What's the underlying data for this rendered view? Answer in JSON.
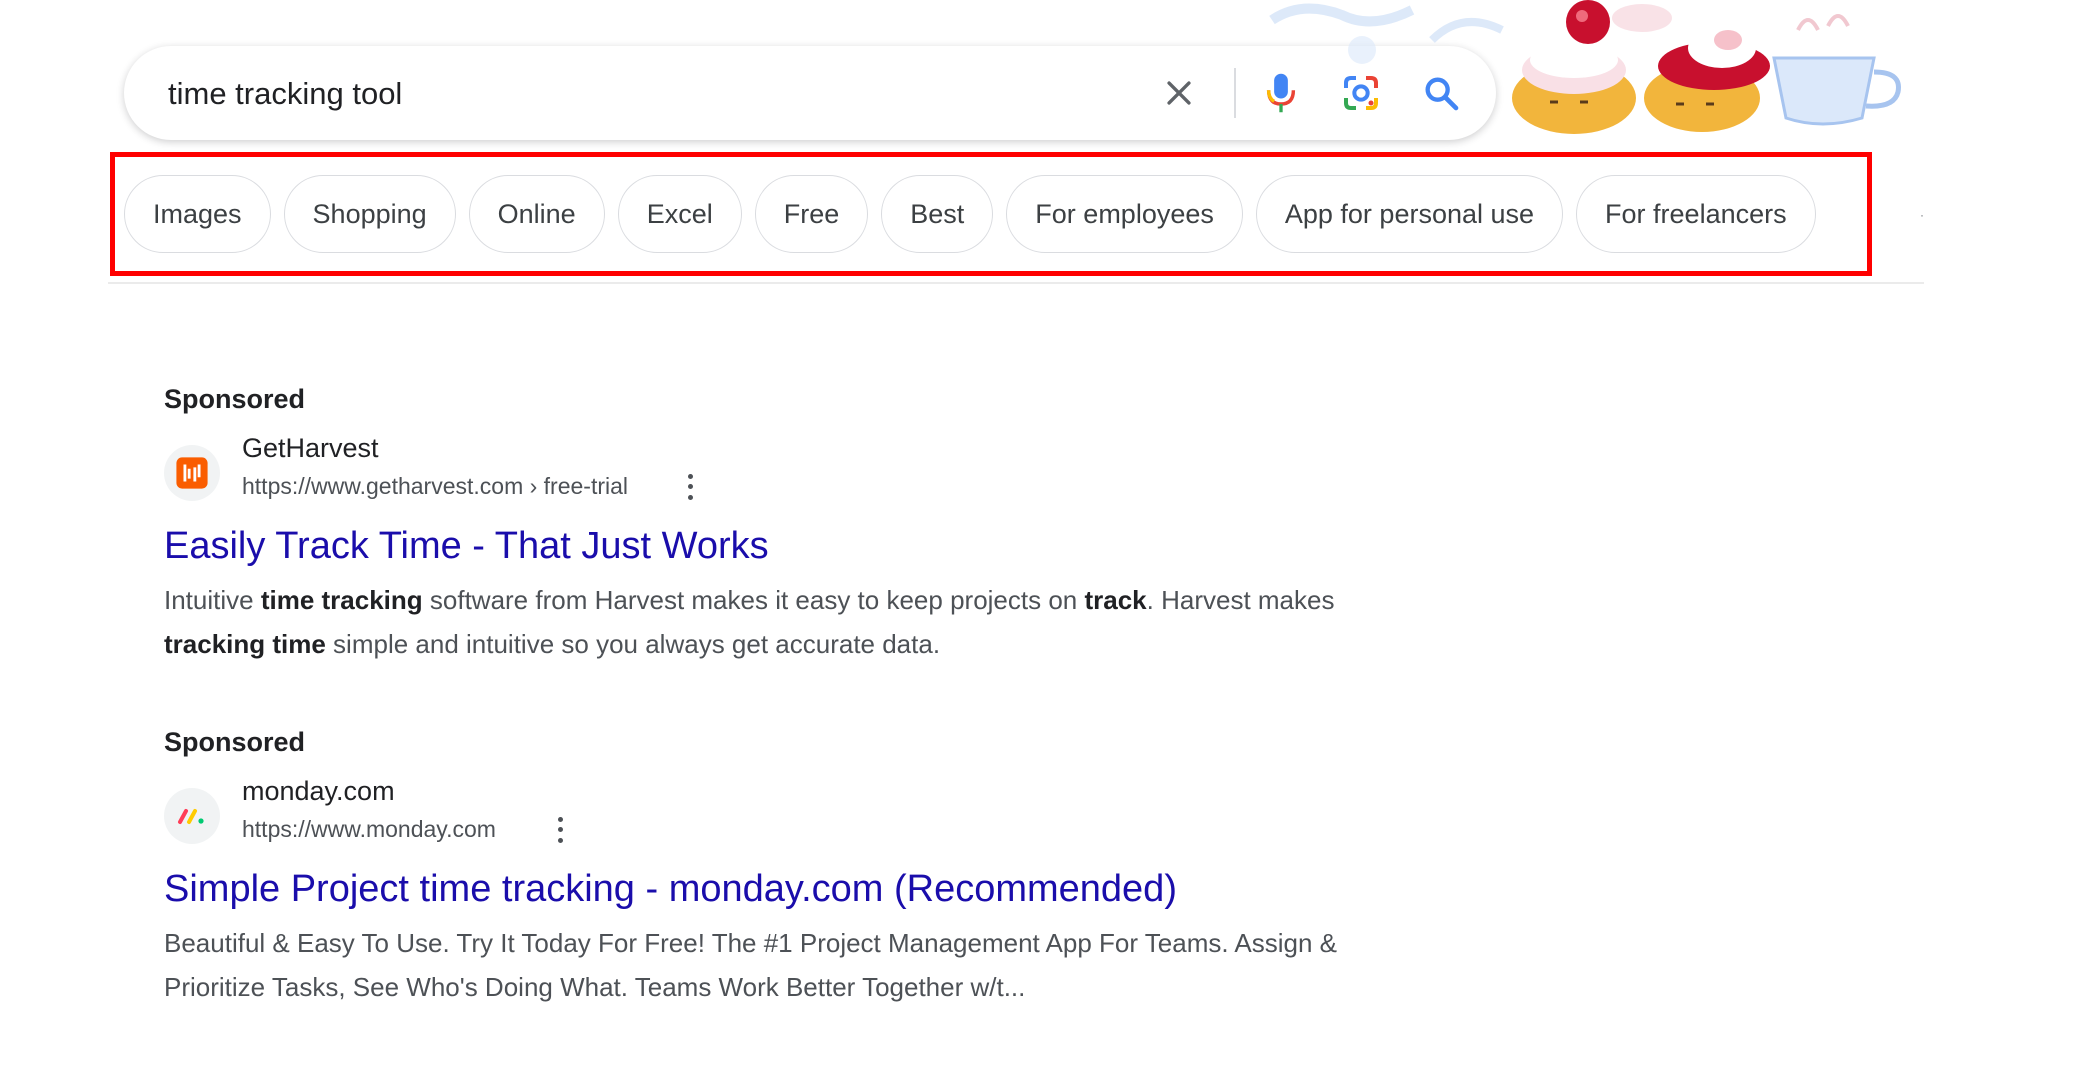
{
  "search": {
    "query": "time tracking tool",
    "clear_icon": "close-icon",
    "voice_icon": "microphone-icon",
    "lens_icon": "camera-lens-icon",
    "search_icon": "search-icon"
  },
  "doodle": {
    "description_icon": "scones-teacup-doodle"
  },
  "chips": [
    {
      "label": "Images"
    },
    {
      "label": "Shopping"
    },
    {
      "label": "Online"
    },
    {
      "label": "Excel"
    },
    {
      "label": "Free"
    },
    {
      "label": "Best"
    },
    {
      "label": "For employees"
    },
    {
      "label": "App for personal use"
    },
    {
      "label": "For freelancers"
    }
  ],
  "results": [
    {
      "sponsored_label": "Sponsored",
      "site_name": "GetHarvest",
      "url": "https://www.getharvest.com › free-trial",
      "favicon": "harvest-logo-icon",
      "favicon_color": "#fa5d00",
      "title": "Easily Track Time - That Just Works",
      "snippet": [
        {
          "text": "Intuitive ",
          "bold": false
        },
        {
          "text": "time tracking",
          "bold": true
        },
        {
          "text": " software from Harvest makes it easy to keep projects on ",
          "bold": false
        },
        {
          "text": "track",
          "bold": true
        },
        {
          "text": ". Harvest makes ",
          "bold": false
        },
        {
          "text": "tracking time",
          "bold": true
        },
        {
          "text": " simple and intuitive so you always get accurate data.",
          "bold": false
        }
      ]
    },
    {
      "sponsored_label": "Sponsored",
      "site_name": "monday.com",
      "url": "https://www.monday.com",
      "favicon": "monday-logo-icon",
      "favicon_color": "#ff3d57",
      "title": "Simple Project time tracking - monday.com (Recommended)",
      "snippet": [
        {
          "text": "Beautiful & Easy To Use. Try It Today For Free! The #1 Project Management App For Teams. Assign & Prioritize Tasks, See Who's Doing What. Teams Work Better Together w/t...",
          "bold": false
        }
      ]
    }
  ],
  "colors": {
    "link": "#1a0dab",
    "highlight": "#ff0000"
  }
}
